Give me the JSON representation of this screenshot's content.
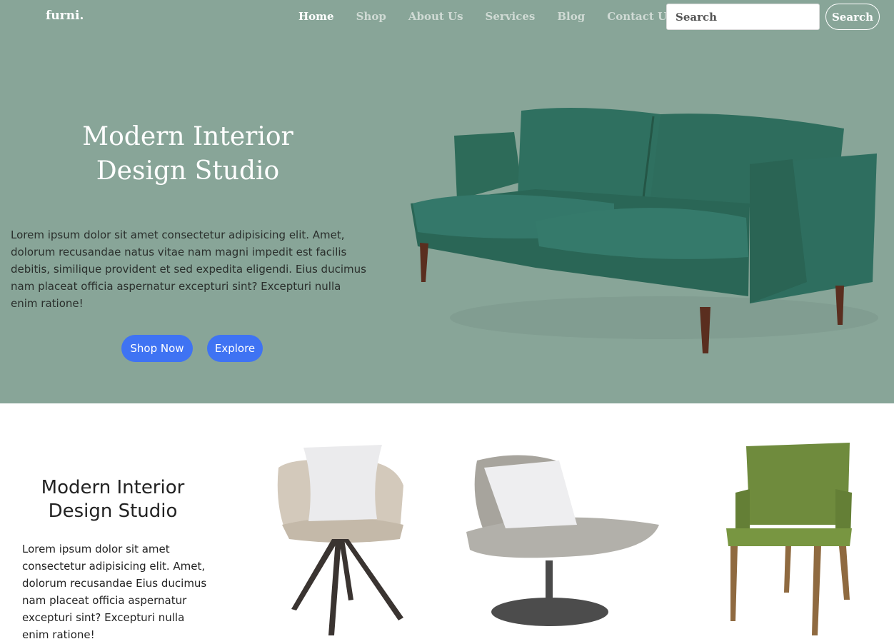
{
  "header": {
    "brand": "furni.",
    "nav": [
      "Home",
      "Shop",
      "About Us",
      "Services",
      "Blog",
      "Contact Us"
    ],
    "search_placeholder": "Search",
    "search_button": "Search"
  },
  "hero": {
    "title_line1": "Modern Interior",
    "title_line2": "Design Studio",
    "text": "Lorem ipsum dolor sit amet consectetur adipisicing elit. Amet, dolorum recusandae natus vitae nam magni impedit est facilis debitis, similique provident et sed expedita eligendi. Eius ducimus nam placeat officia aspernatur excepturi sint? Excepturi nulla enim ratione!",
    "shop_button": "Shop Now",
    "explore_button": "Explore",
    "bg_color": "#88a598",
    "accent_color": "#3f73f3"
  },
  "section": {
    "title_line1": "Modern Interior",
    "title_line2": "Design Studio",
    "text": "Lorem ipsum dolor sit amet consectetur adipisicing elit. Amet, dolorum recusandae Eius ducimus nam placeat officia aspernatur excepturi sint? Excepturi nulla enim ratione!"
  }
}
